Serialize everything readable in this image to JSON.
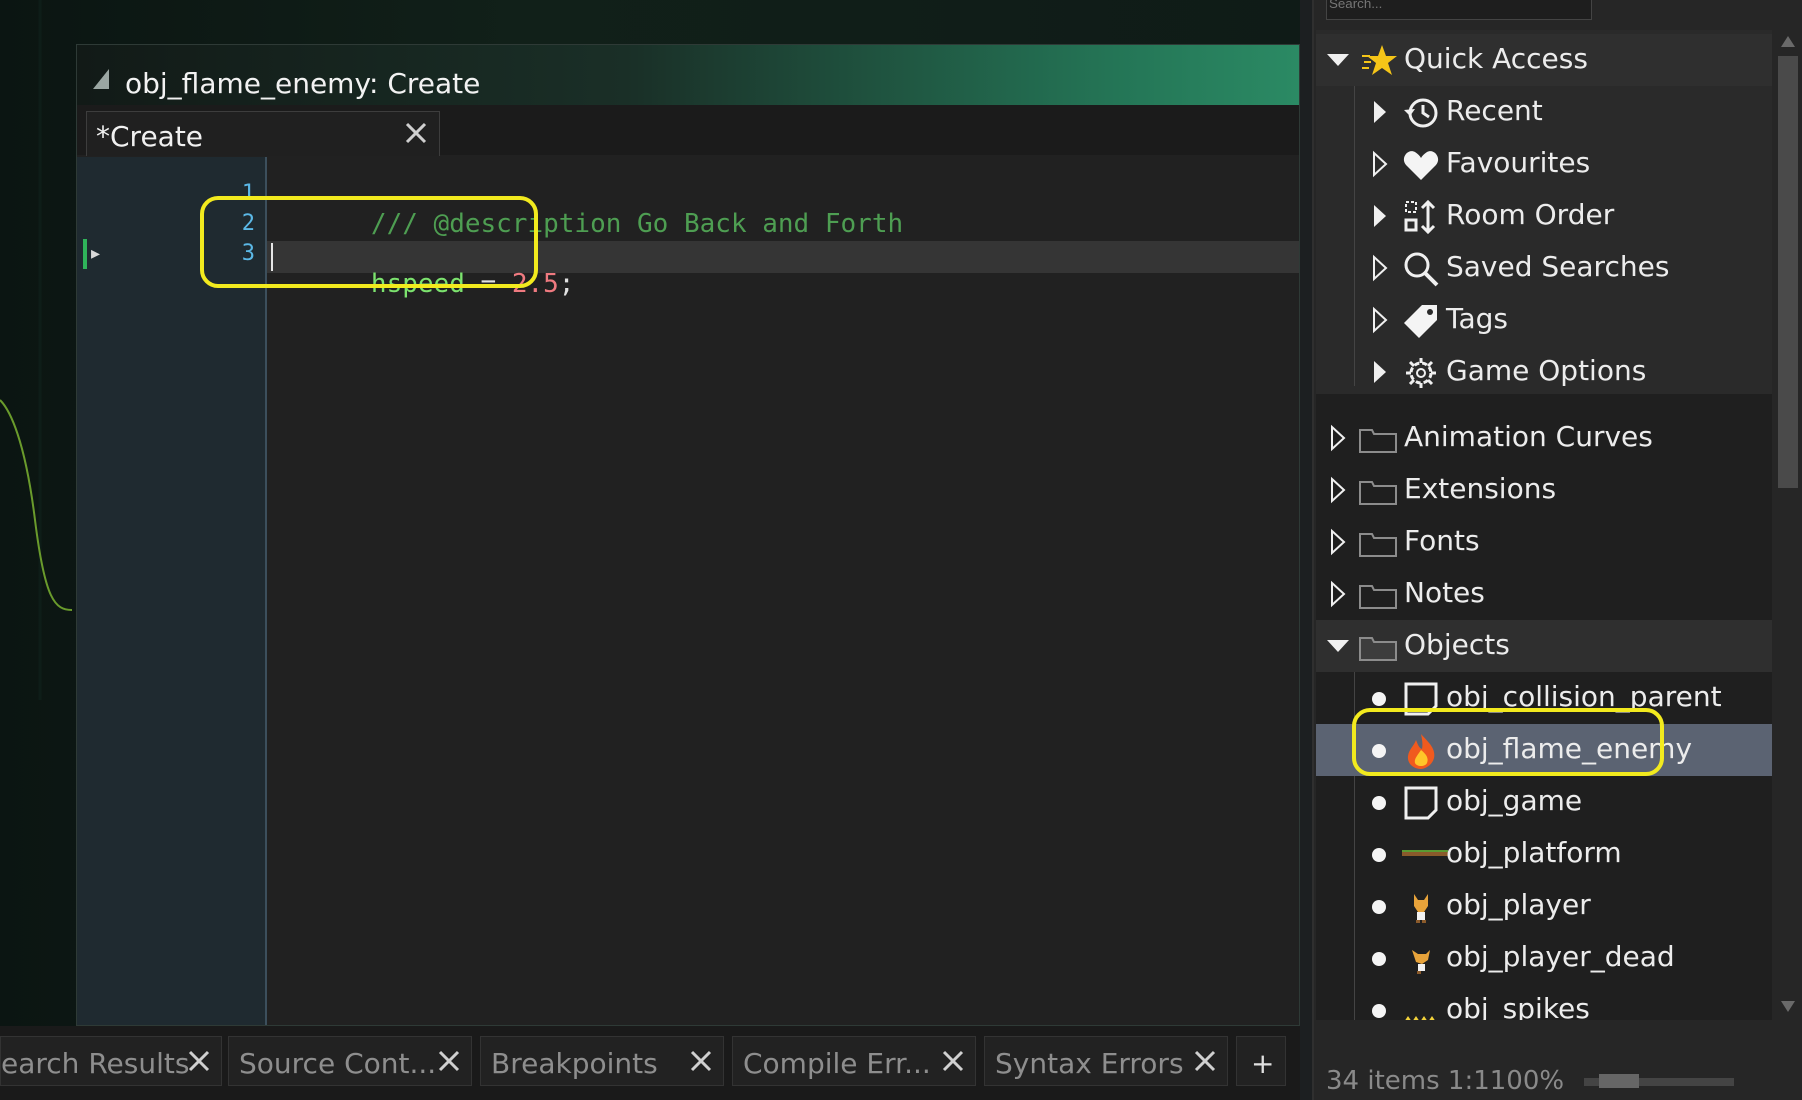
{
  "code_window": {
    "title": "obj_flame_enemy: Create",
    "tab_label": "*Create",
    "line_numbers": [
      "1",
      "2",
      "3"
    ],
    "lines": {
      "comment": "/// @description Go Back and Forth",
      "ident": "hspeed",
      "op": " = ",
      "num": "2.5",
      "semi": ";"
    }
  },
  "bottom_tabs": [
    {
      "label": "earch Results"
    },
    {
      "label": "Source Cont..."
    },
    {
      "label": "Breakpoints"
    },
    {
      "label": "Compile Err..."
    },
    {
      "label": "Syntax Errors"
    }
  ],
  "add_tab_label": "+",
  "asset_browser": {
    "search_placeholder": "Search...",
    "quick_access": {
      "label": "Quick Access",
      "items": [
        {
          "label": "Recent",
          "icon": "history-icon"
        },
        {
          "label": "Favourites",
          "icon": "heart-icon"
        },
        {
          "label": "Room Order",
          "icon": "room-order-icon"
        },
        {
          "label": "Saved Searches",
          "icon": "search-icon"
        },
        {
          "label": "Tags",
          "icon": "tag-icon"
        },
        {
          "label": "Game Options",
          "icon": "gear-icon"
        }
      ]
    },
    "folders": [
      {
        "label": "Animation Curves"
      },
      {
        "label": "Extensions"
      },
      {
        "label": "Fonts"
      },
      {
        "label": "Notes"
      }
    ],
    "objects_folder": {
      "label": "Objects",
      "items": [
        {
          "label": "obj_collision_parent",
          "icon": "blank-object-icon"
        },
        {
          "label": "obj_flame_enemy",
          "icon": "flame-icon"
        },
        {
          "label": "obj_game",
          "icon": "blank-object-icon"
        },
        {
          "label": "obj_platform",
          "icon": "platform-sprite-icon"
        },
        {
          "label": "obj_player",
          "icon": "player-sprite-icon"
        },
        {
          "label": "obj_player_dead",
          "icon": "player-dead-sprite-icon"
        },
        {
          "label": "obj_spikes",
          "icon": "spikes-sprite-icon"
        }
      ]
    },
    "status": "34 items    1:1100%"
  },
  "colors": {
    "highlight": "#f2ea1e",
    "selection": "#5b6372",
    "comment": "#4e9e52",
    "identifier": "#7ce36e",
    "number": "#ef7a80",
    "line_number": "#5bb8e6"
  }
}
